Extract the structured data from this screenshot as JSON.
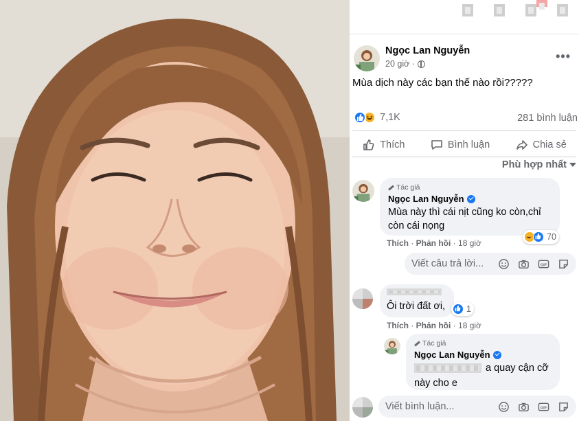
{
  "post": {
    "author": "Ngọc Lan Nguyễn",
    "time": "20 giờ",
    "more_icon": "three-dots-icon",
    "text": "Mùa dịch này các bạn thế nào rồi?????",
    "reaction_count": "7,1K",
    "comment_count": "281 bình luận"
  },
  "actions": {
    "like": "Thích",
    "comment": "Bình luận",
    "share": "Chia sẻ"
  },
  "sort_label": "Phù hợp nhất",
  "comments": [
    {
      "badge": "Tác giả",
      "author": "Ngọc Lan Nguyễn",
      "text_line1": "Mùa này thì cái nịt cũng ko còn,chỉ",
      "text_line2": "còn cái nọng",
      "like": "Thích",
      "reply": "Phản hồi",
      "time": "18 giờ",
      "reaction_count": "70"
    },
    {
      "text": "Ôi trời đất ơi,",
      "like": "Thích",
      "reply": "Phản hồi",
      "time": "18 giờ",
      "reaction_count": "1"
    },
    {
      "badge": "Tác giả",
      "author": "Ngọc Lan Nguyễn",
      "text_line1": "a quay cận cỡ",
      "text_line2": "này cho e"
    }
  ],
  "reply_placeholder": "Viết câu trả lời...",
  "comment_placeholder": "Viết bình luận...",
  "colors": {
    "facebook_blue": "#1877f2",
    "secondary_text": "#65676b",
    "bubble_bg": "#f0f2f5",
    "haha_yellow": "#f7b125"
  }
}
